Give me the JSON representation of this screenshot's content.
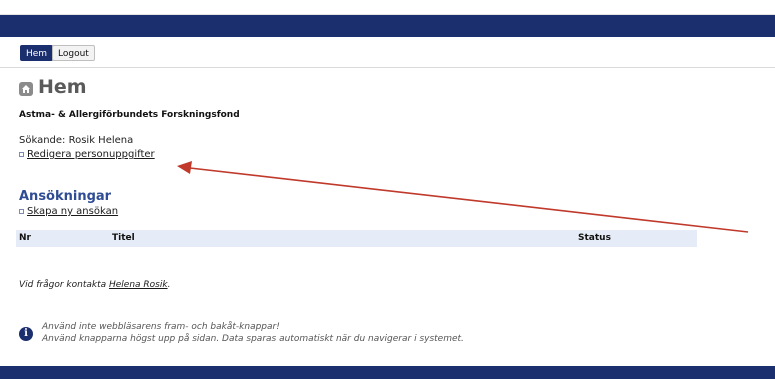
{
  "nav": {
    "home_label": "Hem",
    "logout_label": "Logout"
  },
  "page": {
    "title": "Hem",
    "org_name": "Astma- & Allergiförbundets Forskningsfond",
    "applicant": "Sökande: Rosik Helena",
    "edit_profile_link": "Redigera personuppgifter"
  },
  "applications": {
    "heading": "Ansökningar",
    "new_link": "Skapa ny ansökan",
    "columns": [
      "Nr",
      "Titel",
      "Status"
    ]
  },
  "contact": {
    "prefix": "Vid frågor kontakta ",
    "name": "Helena Rosik",
    "suffix": "."
  },
  "notice": {
    "line1": "Använd inte webbläsarens fram- och bakåt-knappar!",
    "line2": "Använd knapparna högst upp på sidan. Data sparas automatiskt när du navigerar i systemet."
  },
  "colors": {
    "header_bar": "#1b2f6e",
    "section_heading": "#2f4c94",
    "annotation_arrow": "#c0392b"
  },
  "icons": {
    "home": "home-icon",
    "info": "info-icon",
    "bullet": "square-bullet-icon"
  }
}
